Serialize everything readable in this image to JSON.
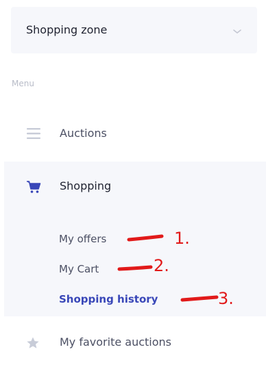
{
  "zone_select": {
    "label": "Shopping zone",
    "chevron_icon": "chevron-down-icon"
  },
  "menu": {
    "caption": "Menu"
  },
  "nav": {
    "auctions": {
      "label": "Auctions",
      "icon": "menu-lines-icon"
    },
    "shopping": {
      "label": "Shopping",
      "icon": "cart-icon",
      "submenu": [
        {
          "label": "My offers",
          "active": false
        },
        {
          "label": "My Cart",
          "active": false
        },
        {
          "label": "Shopping history",
          "active": true
        }
      ]
    },
    "favorite": {
      "label": "My favorite auctions",
      "icon": "star-icon"
    }
  },
  "annotations": [
    {
      "label": "1.",
      "color": "#e11a1a"
    },
    {
      "label": "2.",
      "color": "#e11a1a"
    },
    {
      "label": "3.",
      "color": "#e11a1a"
    }
  ],
  "colors": {
    "accent": "#3947b8",
    "panel": "#f6f7fb",
    "annotation": "#e11a1a"
  }
}
